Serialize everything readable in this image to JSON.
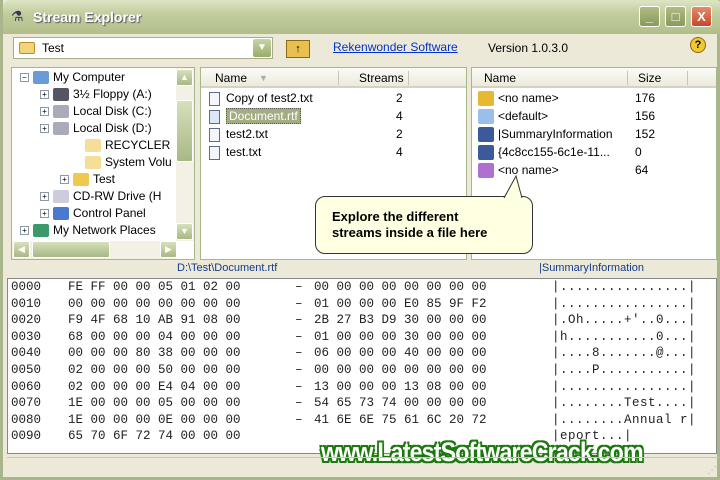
{
  "window": {
    "title": "Stream Explorer",
    "minimize": "_",
    "maximize": "□",
    "close": "X"
  },
  "toolbar": {
    "folder_value": "Test",
    "up_label": "↑",
    "link": "Rekenwonder Software",
    "version": "Version 1.0.3.0",
    "help": "?"
  },
  "tree": {
    "items": [
      {
        "label": "My Computer",
        "expander": "−",
        "icon": "computer-icon"
      },
      {
        "label": "3½ Floppy (A:)",
        "expander": "+",
        "icon": "floppy-icon"
      },
      {
        "label": "Local Disk (C:)",
        "expander": "+",
        "icon": "disk-icon"
      },
      {
        "label": "Local Disk (D:)",
        "expander": "+",
        "icon": "disk-icon"
      },
      {
        "label": "RECYCLER",
        "expander": "",
        "icon": "folder-icon"
      },
      {
        "label": "System Volu",
        "expander": "",
        "icon": "folder-icon"
      },
      {
        "label": "Test",
        "expander": "+",
        "icon": "folder-open-icon"
      },
      {
        "label": "CD-RW Drive (H",
        "expander": "+",
        "icon": "cd-drive-icon"
      },
      {
        "label": "Control Panel",
        "expander": "+",
        "icon": "control-panel-icon"
      },
      {
        "label": "My Network Places",
        "expander": "+",
        "icon": "network-icon"
      }
    ]
  },
  "files": {
    "columns": [
      "Name",
      "Streams"
    ],
    "rows": [
      {
        "name": "Copy of test2.txt",
        "streams": "2"
      },
      {
        "name": "Document.rtf",
        "streams": "4",
        "selected": true
      },
      {
        "name": "test2.txt",
        "streams": "2"
      },
      {
        "name": "test.txt",
        "streams": "4"
      }
    ],
    "path": "D:\\Test\\Document.rtf"
  },
  "streams": {
    "columns": [
      "Name",
      "Size"
    ],
    "rows": [
      {
        "name": "<no name>",
        "size": "176",
        "icon": "key-icon"
      },
      {
        "name": "<default>",
        "size": "156",
        "icon": "document-icon"
      },
      {
        "name": "|SummaryInformation",
        "size": "152",
        "icon": "alt-stream-icon"
      },
      {
        "name": "{4c8cc155-6c1e-11...",
        "size": "0",
        "icon": "alt-stream-icon"
      },
      {
        "name": "<no name>",
        "size": "64",
        "icon": "object-id-icon"
      }
    ],
    "path": "|SummaryInformation"
  },
  "tooltip": {
    "line1": "Explore the different",
    "line2": "streams inside a file here"
  },
  "hex": {
    "rows": [
      {
        "off": "0000",
        "b": [
          "FE",
          "FF",
          "00",
          "00",
          "05",
          "01",
          "02",
          "00",
          "00",
          "00",
          "00",
          "00",
          "00",
          "00",
          "00",
          "00"
        ],
        "ascii": "|................|"
      },
      {
        "off": "0010",
        "b": [
          "00",
          "00",
          "00",
          "00",
          "00",
          "00",
          "00",
          "00",
          "01",
          "00",
          "00",
          "00",
          "E0",
          "85",
          "9F",
          "F2"
        ],
        "ascii": "|................|"
      },
      {
        "off": "0020",
        "b": [
          "F9",
          "4F",
          "68",
          "10",
          "AB",
          "91",
          "08",
          "00",
          "2B",
          "27",
          "B3",
          "D9",
          "30",
          "00",
          "00",
          "00"
        ],
        "ascii": "|.Oh.....+'..0...|"
      },
      {
        "off": "0030",
        "b": [
          "68",
          "00",
          "00",
          "00",
          "04",
          "00",
          "00",
          "00",
          "01",
          "00",
          "00",
          "00",
          "30",
          "00",
          "00",
          "00"
        ],
        "ascii": "|h...........0...|"
      },
      {
        "off": "0040",
        "b": [
          "00",
          "00",
          "00",
          "80",
          "38",
          "00",
          "00",
          "00",
          "06",
          "00",
          "00",
          "00",
          "40",
          "00",
          "00",
          "00"
        ],
        "ascii": "|....8.......@...|"
      },
      {
        "off": "0050",
        "b": [
          "02",
          "00",
          "00",
          "00",
          "50",
          "00",
          "00",
          "00",
          "00",
          "00",
          "00",
          "00",
          "00",
          "00",
          "00",
          "00"
        ],
        "ascii": "|....P...........|"
      },
      {
        "off": "0060",
        "b": [
          "02",
          "00",
          "00",
          "00",
          "E4",
          "04",
          "00",
          "00",
          "13",
          "00",
          "00",
          "00",
          "13",
          "08",
          "00",
          "00"
        ],
        "ascii": "|................|"
      },
      {
        "off": "0070",
        "b": [
          "1E",
          "00",
          "00",
          "00",
          "05",
          "00",
          "00",
          "00",
          "54",
          "65",
          "73",
          "74",
          "00",
          "00",
          "00",
          "00"
        ],
        "ascii": "|........Test....|"
      },
      {
        "off": "0080",
        "b": [
          "1E",
          "00",
          "00",
          "00",
          "0E",
          "00",
          "00",
          "00",
          "41",
          "6E",
          "6E",
          "75",
          "61",
          "6C",
          "20",
          "72"
        ],
        "ascii": "|........Annual r|"
      },
      {
        "off": "0090",
        "b": [
          "65",
          "70",
          "6F",
          "72",
          "74",
          "00",
          "00",
          "00"
        ],
        "ascii": "|eport...|"
      }
    ]
  },
  "watermark": "www.LatestSoftwareCrack.com"
}
